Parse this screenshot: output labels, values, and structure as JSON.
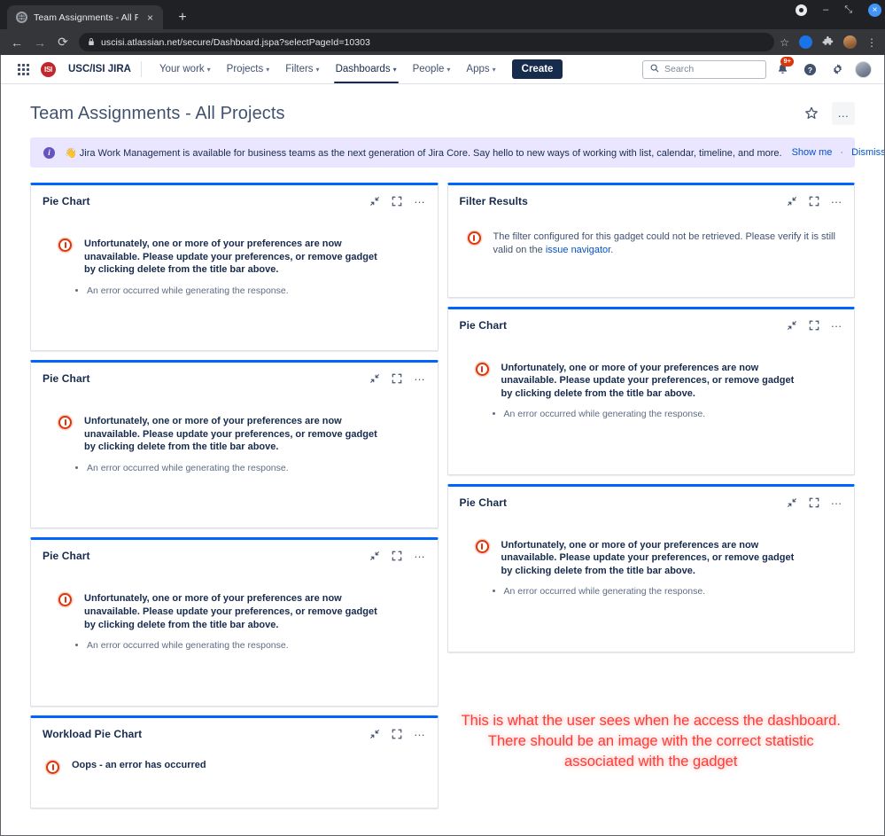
{
  "browser": {
    "tab": {
      "title": "Team Assignments - All Project",
      "close_label": "×",
      "favicon_name": "globe-icon"
    },
    "new_tab_label": "+",
    "window_controls": {
      "minimize": "–",
      "maximize": "⤡",
      "close": "×"
    },
    "nav": {
      "back": "←",
      "forward": "→",
      "reload": "⟳"
    },
    "url": "uscisi.atlassian.net/secure/Dashboard.jspa?selectPageId=10303",
    "lock_label": "🔒",
    "bookmark_label": "☆",
    "menu_label": "⋮"
  },
  "jira_nav": {
    "app_switcher": "apps-grid-icon",
    "logo_text": "ISI",
    "brand": "USC/ISI JIRA",
    "items": [
      {
        "label": "Your work",
        "has_caret": true,
        "active": false
      },
      {
        "label": "Projects",
        "has_caret": true,
        "active": false
      },
      {
        "label": "Filters",
        "has_caret": true,
        "active": false
      },
      {
        "label": "Dashboards",
        "has_caret": true,
        "active": true
      },
      {
        "label": "People",
        "has_caret": true,
        "active": false
      },
      {
        "label": "Apps",
        "has_caret": true,
        "active": false
      }
    ],
    "create_label": "Create",
    "search": {
      "placeholder": "Search",
      "value": ""
    },
    "notifications_badge": "9+",
    "help_label": "?",
    "settings_label": "gear-icon",
    "profile_label": "avatar"
  },
  "dashboard": {
    "title": "Team Assignments - All Projects",
    "star_label": "star-icon",
    "more_label": "…"
  },
  "banner": {
    "icon": "info-icon",
    "emoji": "👋",
    "text": "Jira Work Management is available for business teams as the next generation of Jira Core. Say hello to new ways of working with list, calendar, timeline, and more.",
    "show_me": "Show me",
    "separator": "·",
    "dismiss": "Dismiss"
  },
  "gadget_tools": {
    "collapse": "minimize-icon",
    "maximize": "maximize-icon",
    "menu": "…"
  },
  "errors": {
    "preferences_title": "Unfortunately, one or more of your preferences are now unavailable. Please update your preferences, or remove gadget by clicking delete from the title bar above.",
    "preferences_detail": "An error occurred while generating the response.",
    "filter_text_before": "The filter configured for this gadget could not be retrieved. Please verify it is still valid on the ",
    "filter_link": "issue navigator",
    "filter_text_after": ".",
    "workload_message": "Oops - an error has occurred"
  },
  "gadgets": {
    "left": [
      {
        "title": "Pie Chart",
        "type": "preferences-error"
      },
      {
        "title": "Pie Chart",
        "type": "preferences-error"
      },
      {
        "title": "Pie Chart",
        "type": "preferences-error"
      },
      {
        "title": "Workload Pie Chart",
        "type": "workload-error"
      }
    ],
    "right": [
      {
        "title": "Filter Results",
        "type": "filter-error"
      },
      {
        "title": "Pie Chart",
        "type": "preferences-error"
      },
      {
        "title": "Pie Chart",
        "type": "preferences-error"
      }
    ]
  },
  "annotation": {
    "text": "This is what the user sees when he access the dashboard.  There should be an image with the correct statistic associated with the gadget",
    "color": "#ff3b36"
  }
}
